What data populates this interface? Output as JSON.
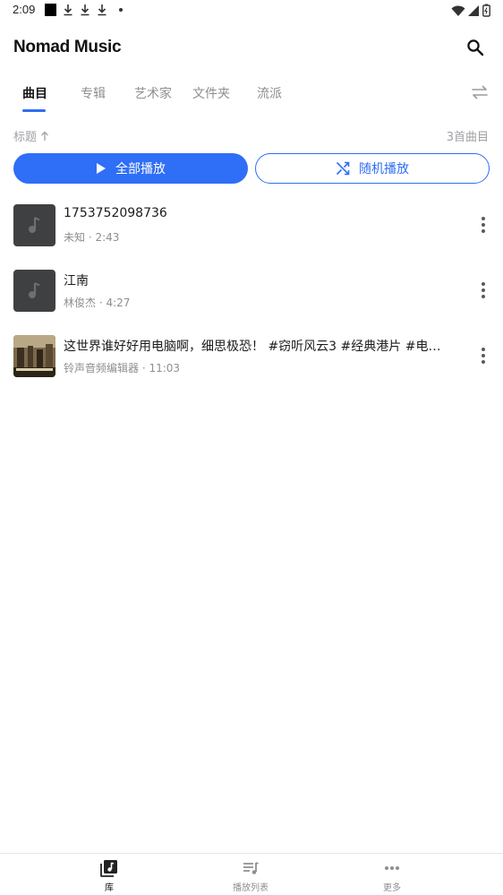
{
  "status_bar": {
    "time": "2:09"
  },
  "app": {
    "title": "Nomad Music"
  },
  "tabs": [
    {
      "label": "曲目",
      "active": true
    },
    {
      "label": "专辑",
      "active": false
    },
    {
      "label": "艺术家",
      "active": false
    },
    {
      "label": "文件夹",
      "active": false
    },
    {
      "label": "流派",
      "active": false
    }
  ],
  "sort": {
    "label": "标题",
    "count": "3首曲目"
  },
  "actions": {
    "play_all": "全部播放",
    "shuffle": "随机播放"
  },
  "tracks": [
    {
      "title": "1753752098736",
      "subtitle": "未知 · 2:43",
      "thumb": "music-note"
    },
    {
      "title": "江南",
      "subtitle": "林俊杰 · 4:27",
      "thumb": "music-note"
    },
    {
      "title": "这世界谁好好用电脑啊，细思极恐！ #窃听风云3 #经典港片 #电影…",
      "subtitle": "铃声音频编辑器 · 11:03",
      "thumb": "photo"
    }
  ],
  "bottom_nav": [
    {
      "label": "库",
      "icon": "library-icon",
      "active": true
    },
    {
      "label": "播放列表",
      "icon": "playlist-icon",
      "active": false
    },
    {
      "label": "更多",
      "icon": "more-horiz-icon",
      "active": false
    }
  ],
  "colors": {
    "accent": "#2f6ef6",
    "thumb_bg": "#3f4042"
  }
}
